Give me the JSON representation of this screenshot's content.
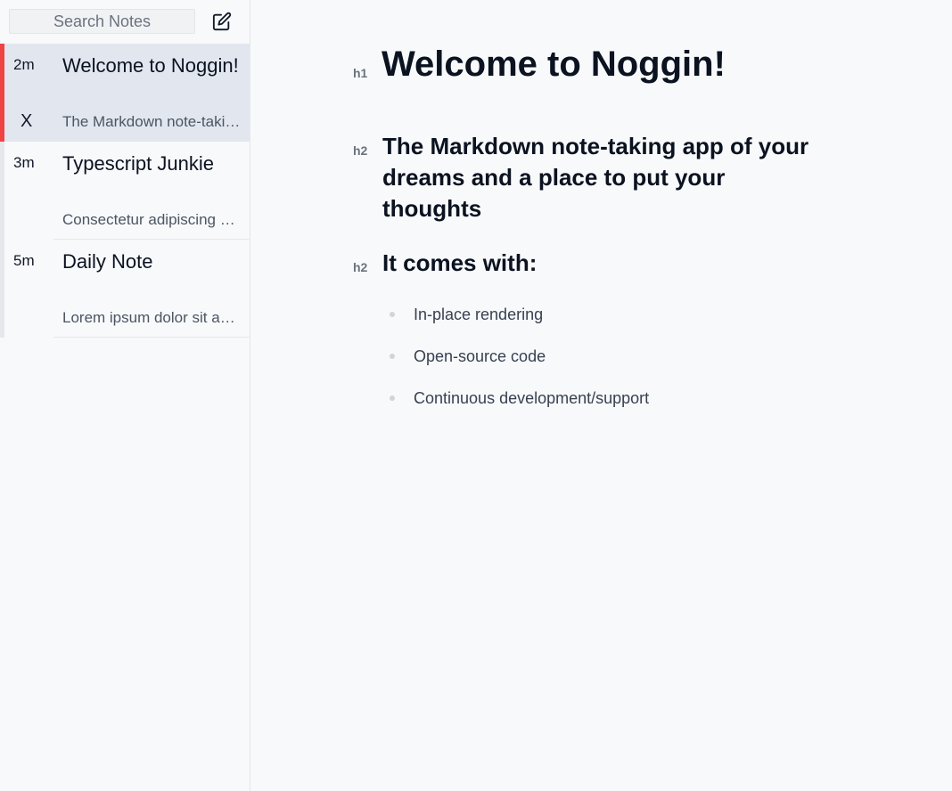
{
  "sidebar": {
    "search": {
      "placeholder": "Search Notes"
    },
    "new_note_icon": "edit-icon",
    "notes": [
      {
        "time": "2m",
        "title": "Welcome to Noggin!",
        "preview": "The Markdown note-taking app of your dreams",
        "delete": "X",
        "active": true
      },
      {
        "time": "3m",
        "title": "Typescript Junkie",
        "preview": "Consectetur adipiscing elit, sed do eiusmod",
        "active": false
      },
      {
        "time": "5m",
        "title": "Daily Note",
        "preview": "Lorem ipsum dolor sit amet, consectetur",
        "active": false
      }
    ]
  },
  "editor": {
    "h1_marker": "h1",
    "h1": "Welcome to Noggin!",
    "h2_marker": "h2",
    "h2_first": "The Markdown note-taking app of your dreams and a place to put your thoughts",
    "h2_second": "It comes with:",
    "bullets": [
      "In-place rendering",
      "Open-source code",
      "Continuous development/support"
    ]
  },
  "colors": {
    "active_indicator": "#ef4444",
    "active_background": "#e2e7ef",
    "background": "#f8f9fb"
  }
}
